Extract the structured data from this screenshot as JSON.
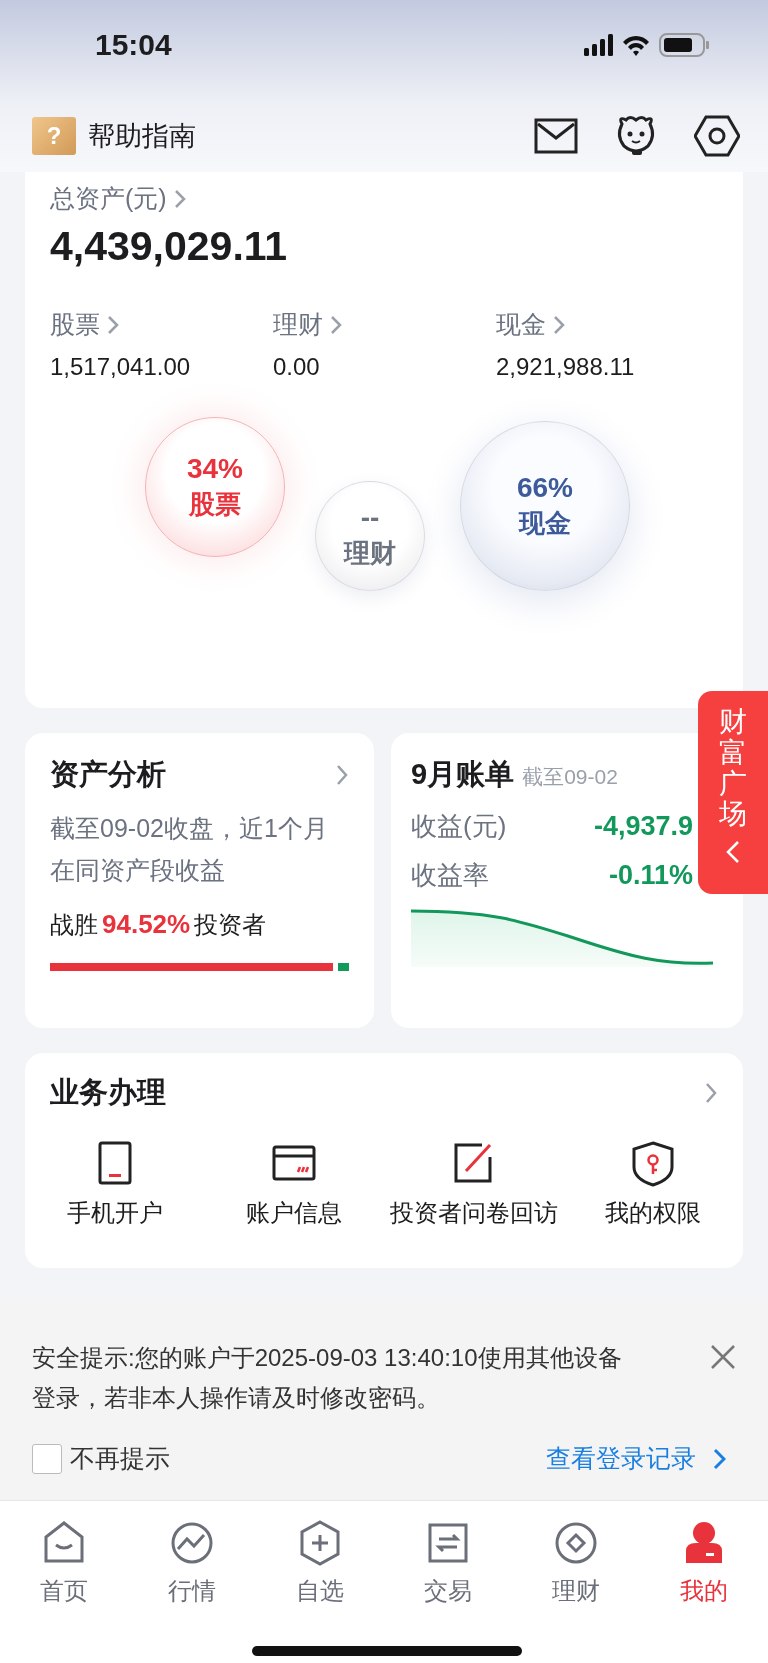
{
  "status_bar": {
    "time": "15:04"
  },
  "header": {
    "title": "帮助指南",
    "help_mark": "?"
  },
  "assets": {
    "label": "总资产(元)",
    "total": "4,439,029.11",
    "categories": [
      {
        "label": "股票",
        "value": "1,517,041.00"
      },
      {
        "label": "理财",
        "value": "0.00"
      },
      {
        "label": "现金",
        "value": "2,921,988.11"
      }
    ],
    "bubbles": [
      {
        "kind": "stock",
        "percent": "34%",
        "label": "股票"
      },
      {
        "kind": "wealth",
        "percent": "--",
        "label": "理财"
      },
      {
        "kind": "cash",
        "percent": "66%",
        "label": "现金"
      }
    ]
  },
  "analysis": {
    "title": "资产分析",
    "description": "截至09-02收盘，近1个月在同资产段收益",
    "result_prefix": "战胜",
    "result_value": "94.52%",
    "result_suffix": "投资者",
    "level": 0.9452
  },
  "bill": {
    "title": "9月账单",
    "date": "截至09-02",
    "rows": [
      {
        "label": "收益(元)",
        "value": "-4,937.9"
      },
      {
        "label": "收益率",
        "value": "-0.11%"
      }
    ]
  },
  "float_tab": {
    "label": "财富广场"
  },
  "services": {
    "title": "业务办理",
    "items": [
      {
        "kind": "phone",
        "label": "手机开户"
      },
      {
        "kind": "card",
        "label": "账户信息"
      },
      {
        "kind": "survey",
        "label": "投资者问卷回访"
      },
      {
        "kind": "shield",
        "label": "我的权限"
      }
    ]
  },
  "notice": {
    "message": "安全提示:您的账户于2025-09-03 13:40:10使用其他设备登录，若非本人操作请及时修改密码。",
    "dont_remind": {
      "label": "不再提示",
      "checked": false
    },
    "link": "查看登录记录"
  },
  "tab_bar": [
    {
      "kind": "home",
      "label": "首页",
      "selected": false
    },
    {
      "kind": "market",
      "label": "行情",
      "selected": false
    },
    {
      "kind": "watch",
      "label": "自选",
      "selected": false
    },
    {
      "kind": "trade",
      "label": "交易",
      "selected": false
    },
    {
      "kind": "wealth",
      "label": "理财",
      "selected": false
    },
    {
      "kind": "me",
      "label": "我的",
      "selected": true
    }
  ]
}
